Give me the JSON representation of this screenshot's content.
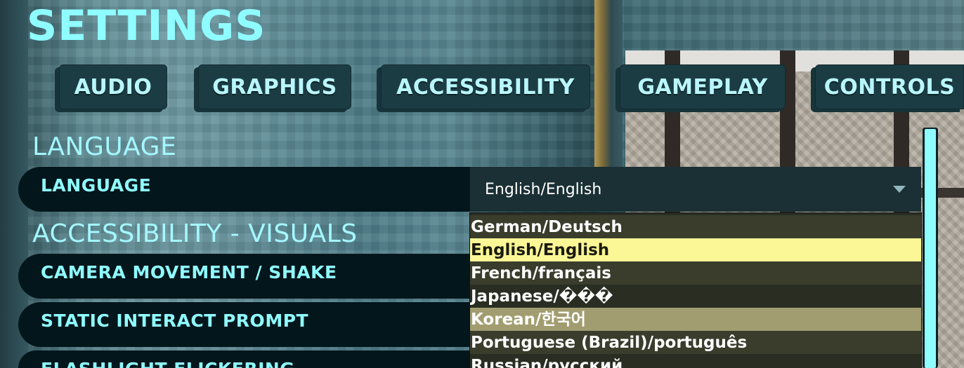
{
  "title": "SETTINGS",
  "tabs": [
    {
      "label": "AUDIO"
    },
    {
      "label": "GRAPHICS"
    },
    {
      "label": "ACCESSIBILITY"
    },
    {
      "label": "GAMEPLAY"
    },
    {
      "label": "CONTROLS"
    }
  ],
  "sections": {
    "language": "LANGUAGE",
    "visuals": "ACCESSIBILITY - VISUALS"
  },
  "rows": {
    "language": "LANGUAGE",
    "camera_shake": "CAMERA MOVEMENT / SHAKE",
    "static_prompt": "STATIC INTERACT PROMPT",
    "flashlight": "FLASHLIGHT FLICKERING"
  },
  "language_dropdown": {
    "selected": "English/English",
    "options": [
      "German/Deutsch",
      "English/English",
      "French/français",
      "Japanese/���",
      "Korean/한국어",
      "Portuguese (Brazil)/português",
      "Russian/русский"
    ]
  },
  "colors": {
    "accent": "#8ffcff",
    "selected_option": "#fbf796",
    "hover_option": "#a29d70"
  }
}
